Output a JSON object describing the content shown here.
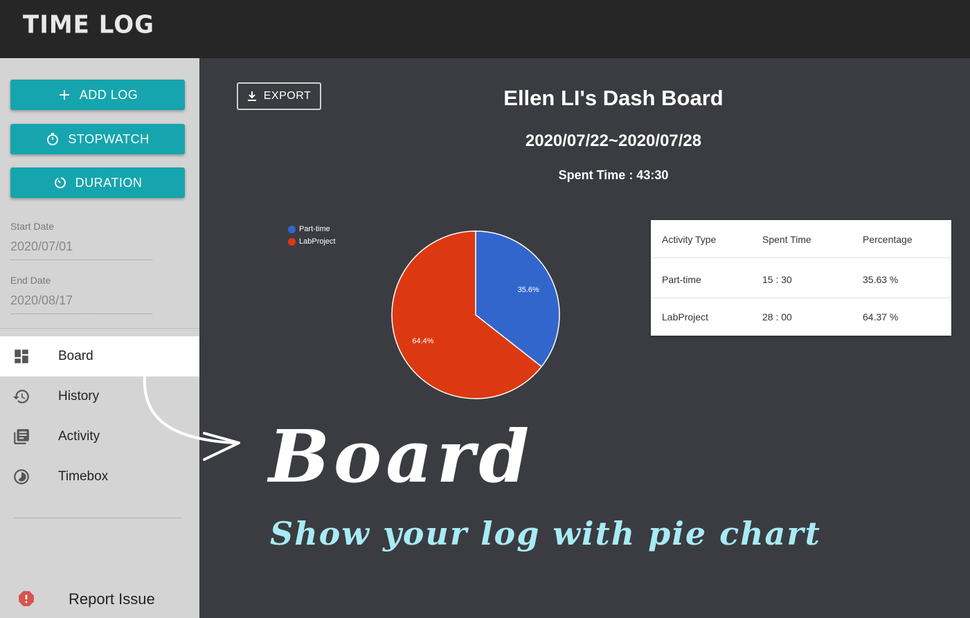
{
  "app": {
    "title": "TIME LOG"
  },
  "sidebar": {
    "buttons": [
      {
        "label": "ADD LOG",
        "icon": "plus-icon"
      },
      {
        "label": "STOPWATCH",
        "icon": "stopwatch-icon"
      },
      {
        "label": "DURATION",
        "icon": "timer-icon"
      }
    ],
    "start_date": {
      "label": "Start Date",
      "value": "2020/07/01"
    },
    "end_date": {
      "label": "End Date",
      "value": "2020/08/17"
    },
    "nav": [
      {
        "label": "Board",
        "icon": "dashboard-icon",
        "active": true
      },
      {
        "label": "History",
        "icon": "history-icon",
        "active": false
      },
      {
        "label": "Activity",
        "icon": "library-books-icon",
        "active": false
      },
      {
        "label": "Timebox",
        "icon": "timelapse-icon",
        "active": false
      }
    ],
    "report": {
      "label": "Report Issue",
      "icon": "alert-icon"
    }
  },
  "main": {
    "export_label": "EXPORT",
    "title": "Ellen LI's Dash Board",
    "date_range": "2020/07/22~2020/07/28",
    "spent_time": "Spent Time : 43:30"
  },
  "chart_data": {
    "type": "pie",
    "slices": [
      {
        "name": "Part-time",
        "value": 35.6,
        "label": "35.6%",
        "color": "#3366cc"
      },
      {
        "name": "LabProject",
        "value": 64.4,
        "label": "64.4%",
        "color": "#dc3912"
      }
    ],
    "legend": [
      "Part-time",
      "LabProject"
    ],
    "legend_position": "top-left"
  },
  "table": {
    "headers": [
      "Activity Type",
      "Spent Time",
      "Percentage"
    ],
    "rows": [
      [
        "Part-time",
        "15 : 30",
        "35.63 %"
      ],
      [
        "LabProject",
        "28 : 00",
        "64.37 %"
      ]
    ]
  },
  "overlay": {
    "heading": "Board",
    "subheading": "Show your log with pie chart",
    "heading_color": "#ffffff",
    "subheading_color": "#a8ebf5"
  },
  "colors": {
    "accent": "#16a5ae",
    "topbar": "#262626",
    "sidebar": "#d4d4d4",
    "content_bg": "#3b3c41",
    "alert": "#d9534f"
  }
}
